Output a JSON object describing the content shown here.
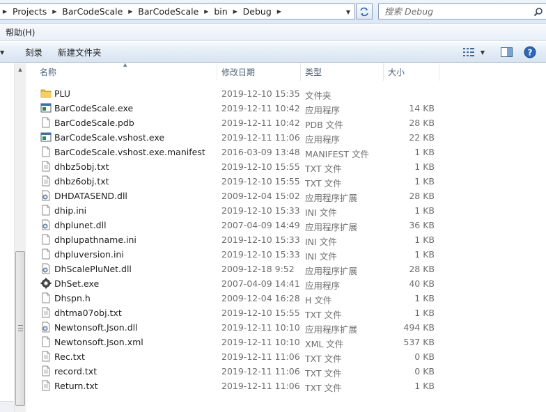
{
  "address": {
    "breadcrumbs": [
      "Projects",
      "BarCodeScale",
      "BarCodeScale",
      "bin",
      "Debug"
    ]
  },
  "search": {
    "placeholder": "搜索 Debug"
  },
  "menu": {
    "help": "帮助(H)"
  },
  "toolbar": {
    "burn": "刻录",
    "new_folder": "新建文件夹"
  },
  "columns": {
    "name": "名称",
    "date": "修改日期",
    "type": "类型",
    "size": "大小"
  },
  "files": [
    {
      "name": "PLU",
      "date": "2019-12-10 15:35",
      "type": "文件夹",
      "size": "",
      "icon": "folder-icon"
    },
    {
      "name": "BarCodeScale.exe",
      "date": "2019-12-11 10:42",
      "type": "应用程序",
      "size": "14 KB",
      "icon": "exe-icon"
    },
    {
      "name": "BarCodeScale.pdb",
      "date": "2019-12-11 10:42",
      "type": "PDB 文件",
      "size": "28 KB",
      "icon": "file-icon"
    },
    {
      "name": "BarCodeScale.vshost.exe",
      "date": "2019-12-11 11:06",
      "type": "应用程序",
      "size": "22 KB",
      "icon": "exe-icon"
    },
    {
      "name": "BarCodeScale.vshost.exe.manifest",
      "date": "2016-03-09 13:48",
      "type": "MANIFEST 文件",
      "size": "1 KB",
      "icon": "file-icon"
    },
    {
      "name": "dhbz5obj.txt",
      "date": "2019-12-10 15:55",
      "type": "TXT 文件",
      "size": "1 KB",
      "icon": "text-file-icon"
    },
    {
      "name": "dhbz6obj.txt",
      "date": "2019-12-10 15:55",
      "type": "TXT 文件",
      "size": "1 KB",
      "icon": "text-file-icon"
    },
    {
      "name": "DHDATASEND.dll",
      "date": "2009-12-04 15:02",
      "type": "应用程序扩展",
      "size": "28 KB",
      "icon": "dll-icon"
    },
    {
      "name": "dhip.ini",
      "date": "2019-12-10 15:33",
      "type": "INI 文件",
      "size": "1 KB",
      "icon": "ini-icon"
    },
    {
      "name": "dhplunet.dll",
      "date": "2007-04-09 14:49",
      "type": "应用程序扩展",
      "size": "36 KB",
      "icon": "dll-icon"
    },
    {
      "name": "dhplupathname.ini",
      "date": "2019-12-10 15:33",
      "type": "INI 文件",
      "size": "1 KB",
      "icon": "ini-icon"
    },
    {
      "name": "dhpluversion.ini",
      "date": "2019-12-10 15:33",
      "type": "INI 文件",
      "size": "1 KB",
      "icon": "ini-icon"
    },
    {
      "name": "DhScalePluNet.dll",
      "date": "2009-12-18 9:52",
      "type": "应用程序扩展",
      "size": "28 KB",
      "icon": "dll-icon"
    },
    {
      "name": "DhSet.exe",
      "date": "2007-04-09 14:41",
      "type": "应用程序",
      "size": "40 KB",
      "icon": "app-gear-icon"
    },
    {
      "name": "Dhspn.h",
      "date": "2009-12-04 16:28",
      "type": "H 文件",
      "size": "1 KB",
      "icon": "file-icon"
    },
    {
      "name": "dhtma07obj.txt",
      "date": "2019-12-10 15:55",
      "type": "TXT 文件",
      "size": "1 KB",
      "icon": "text-file-icon"
    },
    {
      "name": "Newtonsoft.Json.dll",
      "date": "2019-12-11 10:10",
      "type": "应用程序扩展",
      "size": "494 KB",
      "icon": "dll-icon"
    },
    {
      "name": "Newtonsoft.Json.xml",
      "date": "2019-12-11 10:10",
      "type": "XML 文件",
      "size": "537 KB",
      "icon": "file-icon"
    },
    {
      "name": "Rec.txt",
      "date": "2019-12-11 11:06",
      "type": "TXT 文件",
      "size": "0 KB",
      "icon": "text-file-icon"
    },
    {
      "name": "record.txt",
      "date": "2019-12-11 11:06",
      "type": "TXT 文件",
      "size": "0 KB",
      "icon": "text-file-icon"
    },
    {
      "name": "Return.txt",
      "date": "2019-12-11 11:06",
      "type": "TXT 文件",
      "size": "1 KB",
      "icon": "text-file-icon"
    }
  ]
}
